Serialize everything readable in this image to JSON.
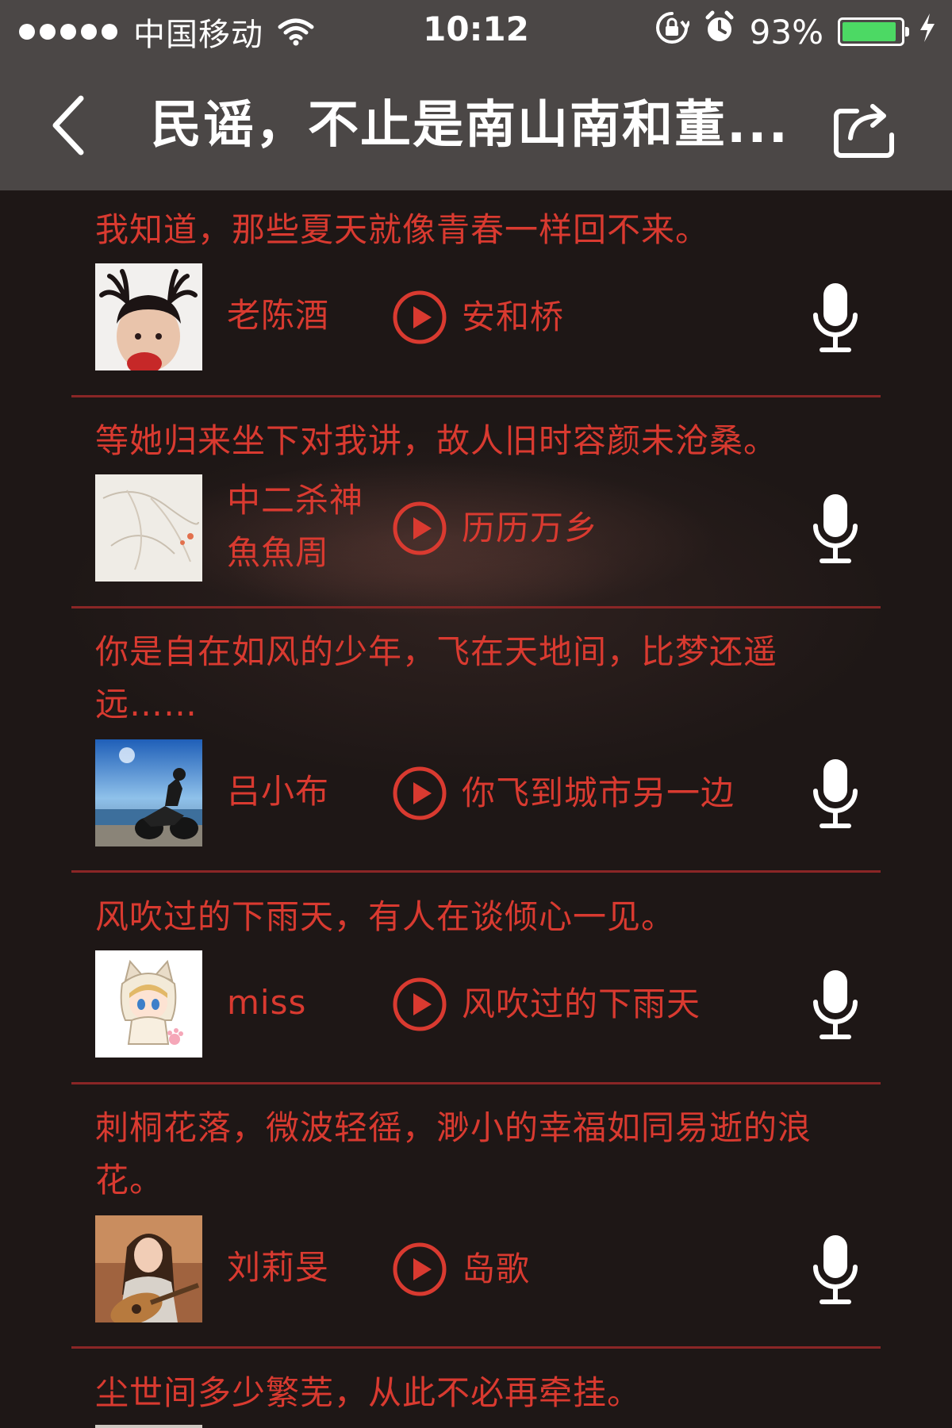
{
  "status_bar": {
    "carrier": "中国移动",
    "time": "10:12",
    "battery_percent": "93%",
    "battery_level": 0.93,
    "icons": [
      "signal-dots-icon",
      "wifi-icon",
      "orientation-lock-icon",
      "alarm-icon",
      "battery-icon",
      "charging-bolt-icon"
    ]
  },
  "nav": {
    "title": "民谣，不止是南山南和董...",
    "back_icon": "chevron-left-icon",
    "share_icon": "share-icon"
  },
  "colors": {
    "accent": "#d93a30",
    "divider": "#8a2626",
    "bar_bg": "#4b4746",
    "page_bg": "#1e1716",
    "battery_green": "#4cd964"
  },
  "entries": [
    {
      "lyric": "我知道，那些夏天就像青春一样回不来。",
      "singer": "老陈酒",
      "song": "安和桥",
      "avatar": "girl-with-pigtails-photo"
    },
    {
      "lyric": "等她归来坐下对我讲，故人旧时容颜未沧桑。",
      "singer": "中二杀神魚魚周",
      "song": "历历万乡",
      "avatar": "sketch-drawing"
    },
    {
      "lyric": "你是自在如风的少年，飞在天地间，比梦还遥远……",
      "singer": "吕小布",
      "song": "你飞到城市另一边",
      "avatar": "motorcycle-by-sea-photo"
    },
    {
      "lyric": "风吹过的下雨天，有人在谈倾心一见。",
      "singer": "miss",
      "song": "风吹过的下雨天",
      "avatar": "anime-cat-girl"
    },
    {
      "lyric": "刺桐花落，微波轻徭，渺小的幸福如同易逝的浪花。",
      "singer": "刘莉旻",
      "song": "岛歌",
      "avatar": "girl-with-guitar-photo"
    },
    {
      "lyric": "尘世间多少繁芜，从此不必再牵挂。",
      "singer": "",
      "song": "",
      "avatar": ""
    }
  ]
}
